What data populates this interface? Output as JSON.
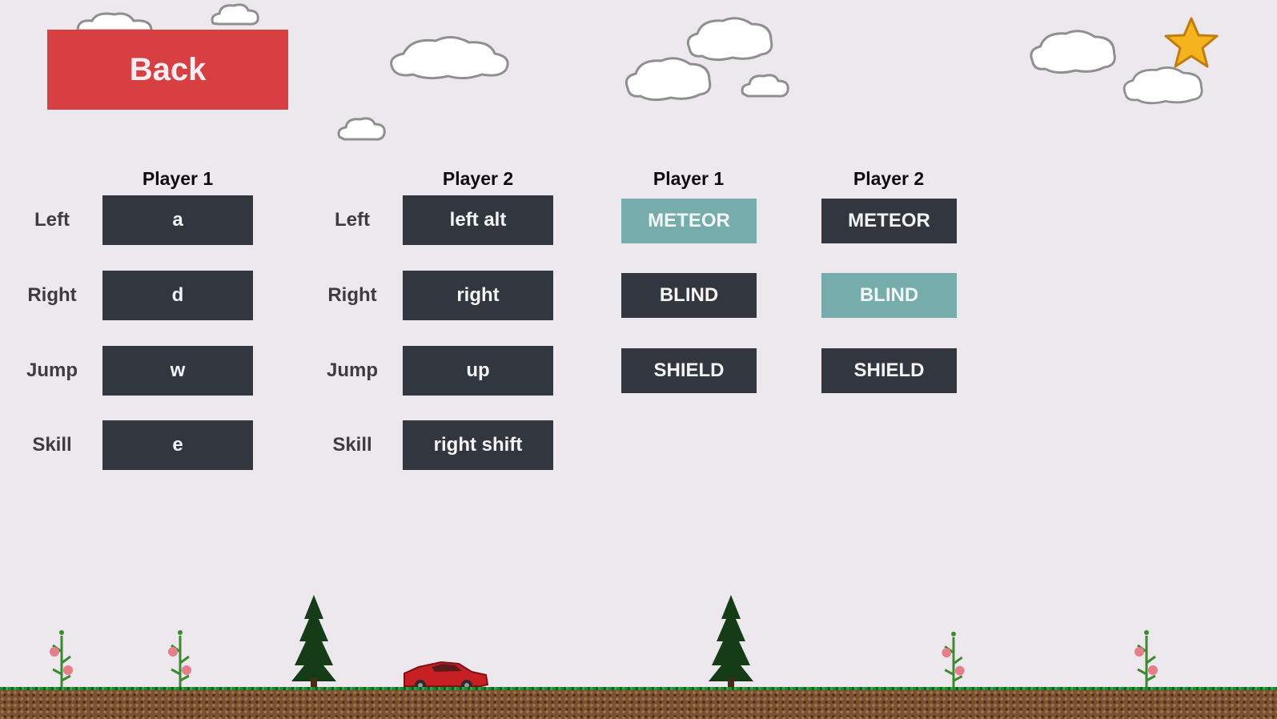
{
  "back_label": "Back",
  "key_columns": [
    {
      "header": "Player 1",
      "rows": [
        {
          "label": "Left",
          "key": "a"
        },
        {
          "label": "Right",
          "key": "d"
        },
        {
          "label": "Jump",
          "key": "w"
        },
        {
          "label": "Skill",
          "key": "e"
        }
      ]
    },
    {
      "header": "Player 2",
      "rows": [
        {
          "label": "Left",
          "key": "left alt"
        },
        {
          "label": "Right",
          "key": "right"
        },
        {
          "label": "Jump",
          "key": "up"
        },
        {
          "label": "Skill",
          "key": "right shift"
        }
      ]
    }
  ],
  "skill_columns": [
    {
      "header": "Player 1",
      "skills": [
        {
          "name": "METEOR",
          "selected": true
        },
        {
          "name": "BLIND",
          "selected": false
        },
        {
          "name": "SHIELD",
          "selected": false
        }
      ]
    },
    {
      "header": "Player 2",
      "skills": [
        {
          "name": "METEOR",
          "selected": false
        },
        {
          "name": "BLIND",
          "selected": true
        },
        {
          "name": "SHIELD",
          "selected": false
        }
      ]
    }
  ],
  "colors": {
    "background": "#ede8ee",
    "back_button": "#d83f42",
    "key_button": "#32363e",
    "skill_selected": "#76acab",
    "star": "#f5b41e"
  },
  "icons": {
    "star": "star-icon",
    "clouds": "cloud-icon",
    "car": "red-car-sprite",
    "trees": "pine-tree-sprite",
    "flowers": "rose-plant-sprite"
  }
}
